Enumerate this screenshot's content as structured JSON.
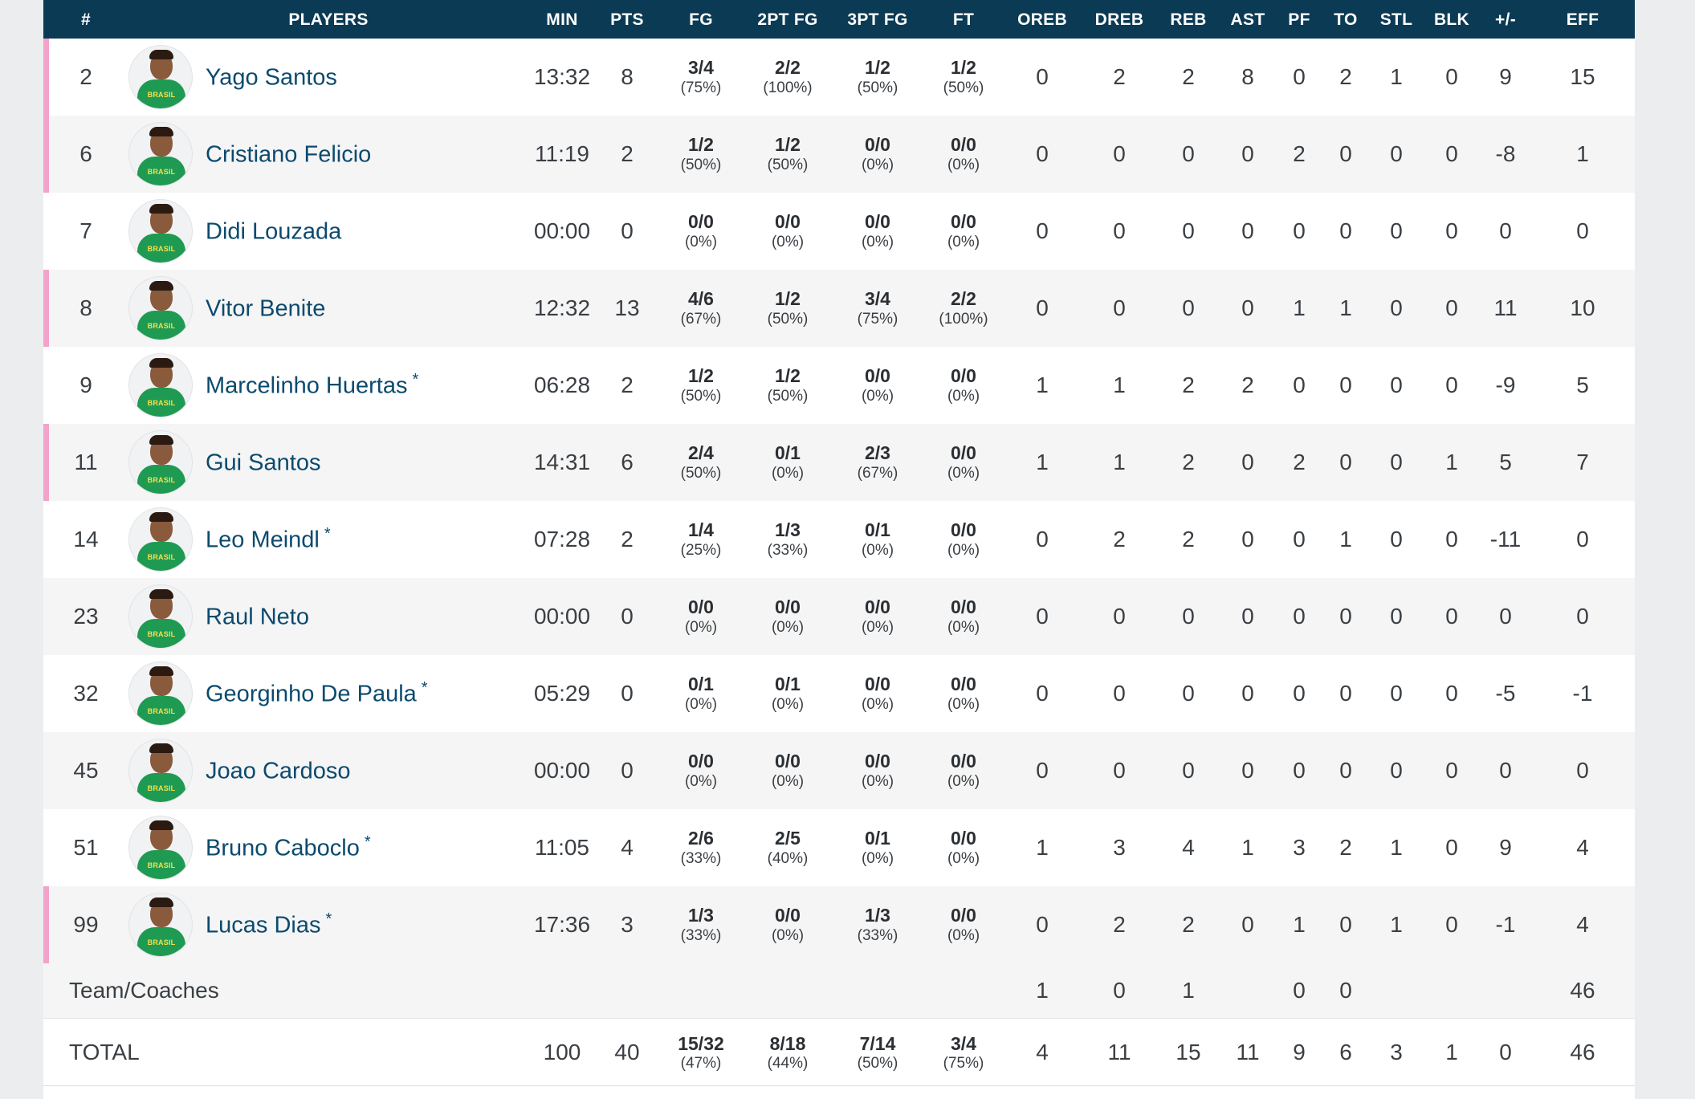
{
  "columns": [
    "#",
    "PLAYERS",
    "MIN",
    "PTS",
    "FG",
    "2PT FG",
    "3PT FG",
    "FT",
    "OREB",
    "DREB",
    "REB",
    "AST",
    "PF",
    "TO",
    "STL",
    "BLK",
    "+/-",
    "EFF"
  ],
  "avatar_jersey_text": "BRASIL",
  "accent_colors": {
    "header_bg": "#0b3a54",
    "starter_marker": "#f2a3c9",
    "player_link": "#0c4a6e"
  },
  "players": [
    {
      "num": "2",
      "name": "Yago Santos",
      "star": "",
      "starter": true,
      "min": "13:32",
      "pts": "8",
      "fg": "3/4",
      "fg_pct": "(75%)",
      "fg2": "2/2",
      "fg2_pct": "(100%)",
      "fg3": "1/2",
      "fg3_pct": "(50%)",
      "ft": "1/2",
      "ft_pct": "(50%)",
      "oreb": "0",
      "dreb": "2",
      "reb": "2",
      "ast": "8",
      "pf": "0",
      "to": "2",
      "stl": "1",
      "blk": "0",
      "pm": "9",
      "eff": "15"
    },
    {
      "num": "6",
      "name": "Cristiano Felicio",
      "star": "",
      "starter": true,
      "min": "11:19",
      "pts": "2",
      "fg": "1/2",
      "fg_pct": "(50%)",
      "fg2": "1/2",
      "fg2_pct": "(50%)",
      "fg3": "0/0",
      "fg3_pct": "(0%)",
      "ft": "0/0",
      "ft_pct": "(0%)",
      "oreb": "0",
      "dreb": "0",
      "reb": "0",
      "ast": "0",
      "pf": "2",
      "to": "0",
      "stl": "0",
      "blk": "0",
      "pm": "-8",
      "eff": "1"
    },
    {
      "num": "7",
      "name": "Didi Louzada",
      "star": "",
      "starter": false,
      "min": "00:00",
      "pts": "0",
      "fg": "0/0",
      "fg_pct": "(0%)",
      "fg2": "0/0",
      "fg2_pct": "(0%)",
      "fg3": "0/0",
      "fg3_pct": "(0%)",
      "ft": "0/0",
      "ft_pct": "(0%)",
      "oreb": "0",
      "dreb": "0",
      "reb": "0",
      "ast": "0",
      "pf": "0",
      "to": "0",
      "stl": "0",
      "blk": "0",
      "pm": "0",
      "eff": "0"
    },
    {
      "num": "8",
      "name": "Vitor Benite",
      "star": "",
      "starter": true,
      "min": "12:32",
      "pts": "13",
      "fg": "4/6",
      "fg_pct": "(67%)",
      "fg2": "1/2",
      "fg2_pct": "(50%)",
      "fg3": "3/4",
      "fg3_pct": "(75%)",
      "ft": "2/2",
      "ft_pct": "(100%)",
      "oreb": "0",
      "dreb": "0",
      "reb": "0",
      "ast": "0",
      "pf": "1",
      "to": "1",
      "stl": "0",
      "blk": "0",
      "pm": "11",
      "eff": "10"
    },
    {
      "num": "9",
      "name": "Marcelinho Huertas",
      "star": "*",
      "starter": false,
      "min": "06:28",
      "pts": "2",
      "fg": "1/2",
      "fg_pct": "(50%)",
      "fg2": "1/2",
      "fg2_pct": "(50%)",
      "fg3": "0/0",
      "fg3_pct": "(0%)",
      "ft": "0/0",
      "ft_pct": "(0%)",
      "oreb": "1",
      "dreb": "1",
      "reb": "2",
      "ast": "2",
      "pf": "0",
      "to": "0",
      "stl": "0",
      "blk": "0",
      "pm": "-9",
      "eff": "5"
    },
    {
      "num": "11",
      "name": "Gui Santos",
      "star": "",
      "starter": true,
      "min": "14:31",
      "pts": "6",
      "fg": "2/4",
      "fg_pct": "(50%)",
      "fg2": "0/1",
      "fg2_pct": "(0%)",
      "fg3": "2/3",
      "fg3_pct": "(67%)",
      "ft": "0/0",
      "ft_pct": "(0%)",
      "oreb": "1",
      "dreb": "1",
      "reb": "2",
      "ast": "0",
      "pf": "2",
      "to": "0",
      "stl": "0",
      "blk": "1",
      "pm": "5",
      "eff": "7"
    },
    {
      "num": "14",
      "name": "Leo Meindl",
      "star": "*",
      "starter": false,
      "min": "07:28",
      "pts": "2",
      "fg": "1/4",
      "fg_pct": "(25%)",
      "fg2": "1/3",
      "fg2_pct": "(33%)",
      "fg3": "0/1",
      "fg3_pct": "(0%)",
      "ft": "0/0",
      "ft_pct": "(0%)",
      "oreb": "0",
      "dreb": "2",
      "reb": "2",
      "ast": "0",
      "pf": "0",
      "to": "1",
      "stl": "0",
      "blk": "0",
      "pm": "-11",
      "eff": "0"
    },
    {
      "num": "23",
      "name": "Raul Neto",
      "star": "",
      "starter": false,
      "min": "00:00",
      "pts": "0",
      "fg": "0/0",
      "fg_pct": "(0%)",
      "fg2": "0/0",
      "fg2_pct": "(0%)",
      "fg3": "0/0",
      "fg3_pct": "(0%)",
      "ft": "0/0",
      "ft_pct": "(0%)",
      "oreb": "0",
      "dreb": "0",
      "reb": "0",
      "ast": "0",
      "pf": "0",
      "to": "0",
      "stl": "0",
      "blk": "0",
      "pm": "0",
      "eff": "0"
    },
    {
      "num": "32",
      "name": "Georginho De Paula",
      "star": "*",
      "starter": false,
      "min": "05:29",
      "pts": "0",
      "fg": "0/1",
      "fg_pct": "(0%)",
      "fg2": "0/1",
      "fg2_pct": "(0%)",
      "fg3": "0/0",
      "fg3_pct": "(0%)",
      "ft": "0/0",
      "ft_pct": "(0%)",
      "oreb": "0",
      "dreb": "0",
      "reb": "0",
      "ast": "0",
      "pf": "0",
      "to": "0",
      "stl": "0",
      "blk": "0",
      "pm": "-5",
      "eff": "-1"
    },
    {
      "num": "45",
      "name": "Joao Cardoso",
      "star": "",
      "starter": false,
      "min": "00:00",
      "pts": "0",
      "fg": "0/0",
      "fg_pct": "(0%)",
      "fg2": "0/0",
      "fg2_pct": "(0%)",
      "fg3": "0/0",
      "fg3_pct": "(0%)",
      "ft": "0/0",
      "ft_pct": "(0%)",
      "oreb": "0",
      "dreb": "0",
      "reb": "0",
      "ast": "0",
      "pf": "0",
      "to": "0",
      "stl": "0",
      "blk": "0",
      "pm": "0",
      "eff": "0"
    },
    {
      "num": "51",
      "name": "Bruno Caboclo",
      "star": "*",
      "starter": false,
      "min": "11:05",
      "pts": "4",
      "fg": "2/6",
      "fg_pct": "(33%)",
      "fg2": "2/5",
      "fg2_pct": "(40%)",
      "fg3": "0/1",
      "fg3_pct": "(0%)",
      "ft": "0/0",
      "ft_pct": "(0%)",
      "oreb": "1",
      "dreb": "3",
      "reb": "4",
      "ast": "1",
      "pf": "3",
      "to": "2",
      "stl": "1",
      "blk": "0",
      "pm": "9",
      "eff": "4"
    },
    {
      "num": "99",
      "name": "Lucas Dias",
      "star": "*",
      "starter": true,
      "min": "17:36",
      "pts": "3",
      "fg": "1/3",
      "fg_pct": "(33%)",
      "fg2": "0/0",
      "fg2_pct": "(0%)",
      "fg3": "1/3",
      "fg3_pct": "(33%)",
      "ft": "0/0",
      "ft_pct": "(0%)",
      "oreb": "0",
      "dreb": "2",
      "reb": "2",
      "ast": "0",
      "pf": "1",
      "to": "0",
      "stl": "1",
      "blk": "0",
      "pm": "-1",
      "eff": "4"
    }
  ],
  "team": {
    "label": "Team/Coaches",
    "oreb": "1",
    "dreb": "0",
    "reb": "1",
    "ast": "",
    "pf": "0",
    "to": "0",
    "stl": "",
    "blk": "",
    "pm": "",
    "eff": "46"
  },
  "total": {
    "label": "TOTAL",
    "min": "100",
    "pts": "40",
    "fg": "15/32",
    "fg_pct": "(47%)",
    "fg2": "8/18",
    "fg2_pct": "(44%)",
    "fg3": "7/14",
    "fg3_pct": "(50%)",
    "ft": "3/4",
    "ft_pct": "(75%)",
    "oreb": "4",
    "dreb": "11",
    "reb": "15",
    "ast": "11",
    "pf": "9",
    "to": "6",
    "stl": "3",
    "blk": "1",
    "pm": "0",
    "eff": "46"
  }
}
